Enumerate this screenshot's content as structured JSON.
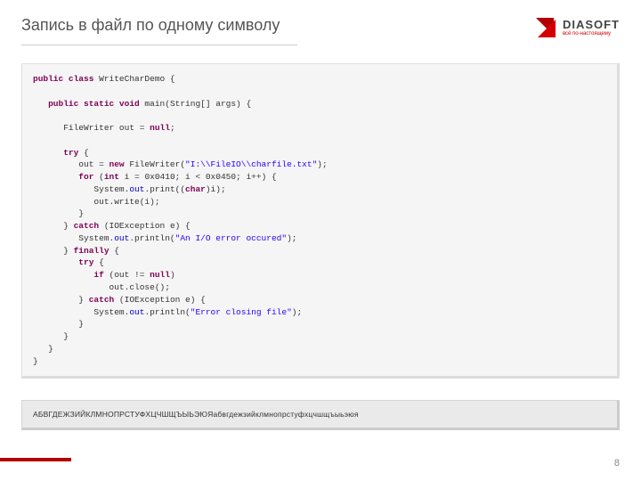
{
  "header": {
    "title": "Запись в файл по одному символу"
  },
  "logo": {
    "name": "DIASOFT",
    "tagline": "всё по-настоящему"
  },
  "code": {
    "l1a": "public class",
    "l1b": " WriteCharDemo {",
    "l2a": "   public static void",
    "l2b": " main(String[] args) {",
    "l3a": "      FileWriter out = ",
    "l3b": "null",
    "l3c": ";",
    "l4a": "      try",
    "l4b": " {",
    "l5a": "         out = ",
    "l5b": "new",
    "l5c": " FileWriter(",
    "l5d": "\"I:\\\\FileIO\\\\charfile.txt\"",
    "l5e": ");",
    "l6a": "         for",
    "l6b": " (",
    "l6c": "int",
    "l6d": " i = 0x0410; i < 0x0450; i++) {",
    "l7a": "            System.",
    "l7b": "out",
    "l7c": ".print((",
    "l7d": "char",
    "l7e": ")i);",
    "l8": "            out.write(i);",
    "l9": "         }",
    "l10a": "      } ",
    "l10b": "catch",
    "l10c": " (IOException e) {",
    "l11a": "         System.",
    "l11b": "out",
    "l11c": ".println(",
    "l11d": "\"An I/O error occured\"",
    "l11e": ");",
    "l12a": "      } ",
    "l12b": "finally",
    "l12c": " {",
    "l13a": "         try",
    "l13b": " {",
    "l14a": "            if",
    "l14b": " (out != ",
    "l14c": "null",
    "l14d": ")",
    "l15": "               out.close();",
    "l16a": "         } ",
    "l16b": "catch",
    "l16c": " (IOException e) {",
    "l17a": "            System.",
    "l17b": "out",
    "l17c": ".println(",
    "l17d": "\"Error closing file\"",
    "l17e": ");",
    "l18": "         }",
    "l19": "      }",
    "l20": "   }",
    "l21": "}"
  },
  "output": "АБВГДЕЖЗИЙКЛМНОПРСТУФХЦЧШЩЪЫЬЭЮЯабвгдежзийклмнопрстуфхцчшщъыьэюя",
  "page": "8"
}
